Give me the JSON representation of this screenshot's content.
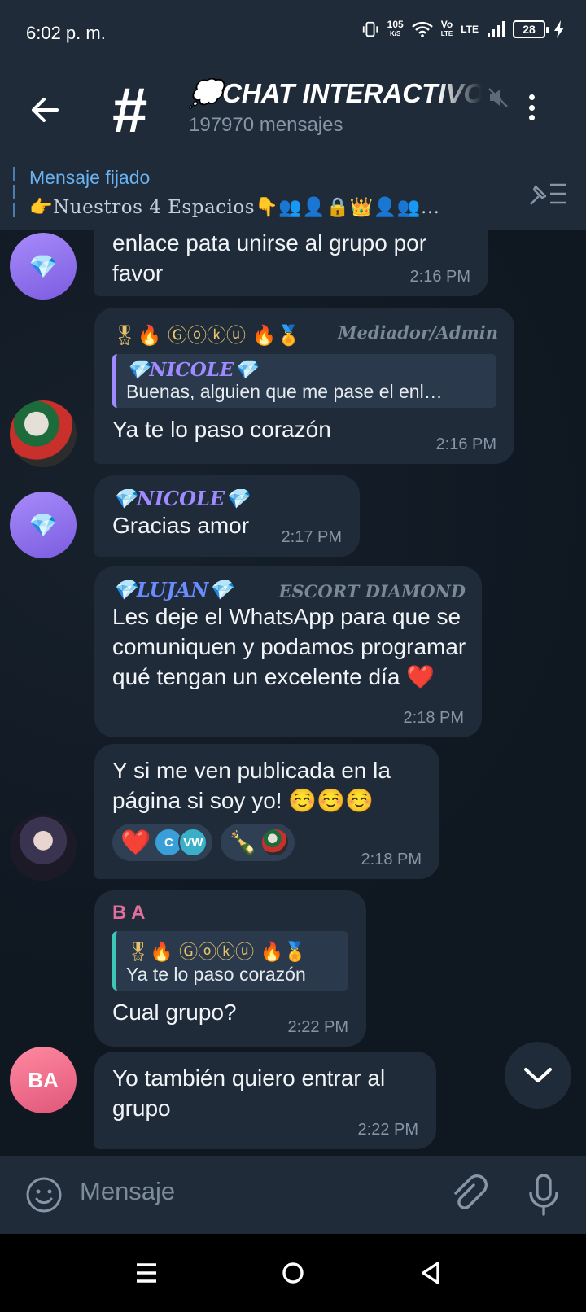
{
  "status": {
    "time": "6:02 p. m.",
    "speed": "105",
    "speed_unit": "K/S",
    "volte": "Vo\nLTE",
    "lte": "LTE",
    "battery": "28"
  },
  "header": {
    "title": "💭CHAT INTERACTIVO",
    "subtitle": "197970 mensajes",
    "icon": "hash-icon"
  },
  "pinned": {
    "title": "Mensaje fijado",
    "text": "👉Nuestros 4 Espacios👇👥👤🔒👑👤👥..."
  },
  "messages": [
    {
      "text": "enlace pata unirse al grupo por favor",
      "time": "2:16 PM"
    },
    {
      "sender": "🎖🔥 Ⓖⓞⓚⓤ 🔥🏅",
      "role": "Mediador/Admin",
      "reply_name": "💎NICOLE💎",
      "reply_text": "Buenas, alguien que me pase el enl…",
      "text": "Ya te lo paso corazón",
      "time": "2:16 PM"
    },
    {
      "sender": "💎NICOLE💎",
      "text": "Gracias amor",
      "time": "2:17 PM"
    },
    {
      "sender": "💎LUJAN💎",
      "role": "ESCORT DIAMOND",
      "text": "Les deje el WhatsApp para que se comuniquen y podamos programar qué tengan un excelente día ❤️",
      "time": "2:18 PM"
    },
    {
      "text": "Y si me ven publicada en la página si soy yo! ☺️☺️☺️",
      "time": "2:18 PM",
      "reactions": [
        {
          "emoji": "❤️",
          "users": [
            "C",
            "VW"
          ]
        },
        {
          "emoji": "🍾",
          "users": [
            ""
          ]
        }
      ]
    },
    {
      "sender": "B A",
      "reply_name": "🎖🔥 Ⓖⓞⓚⓤ 🔥🏅",
      "reply_text": "Ya te lo paso corazón",
      "text": "Cual grupo?",
      "time": "2:22 PM"
    },
    {
      "text": "Yo también quiero entrar al grupo",
      "time": "2:22 PM",
      "avatar": "BA"
    }
  ],
  "input": {
    "placeholder": "Mensaje"
  },
  "colors": {
    "bg": "#0f1721",
    "bubble": "#1f2b38",
    "accent": "#6ab3f3",
    "nicole": "#9f8bff",
    "lujan": "#6b8cff",
    "ba": "#e0709a",
    "goku_reply": "#3ec7b8"
  }
}
